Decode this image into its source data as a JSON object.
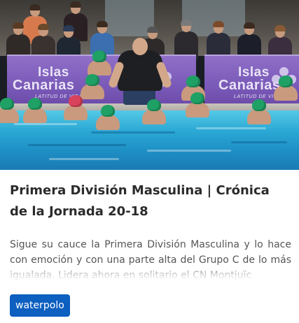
{
  "article": {
    "title": "Primera División Masculina | Crónica de la Jornada 20-18",
    "excerpt": "Sigue su cauce la Primera División Masculina y lo hace con emoción y con una parte alta del Grupo C de lo más igualada. Lidera ahora en solitario el CN Montjuïc",
    "tag": "waterpolo"
  },
  "photo": {
    "banner_brand_line1": "Islas",
    "banner_brand_line2": "Canarias",
    "banner_tagline": "LATITUD DE VIDA",
    "colors": {
      "banner": "#7a5ab8",
      "water": "#2aa8d4",
      "cap_green": "#1fa065",
      "cap_red": "#d8425a"
    }
  },
  "colors": {
    "title": "#2b2b2b",
    "excerpt": "#555555",
    "tag_background": "#0d5fc0",
    "tag_text": "#ffffff"
  }
}
